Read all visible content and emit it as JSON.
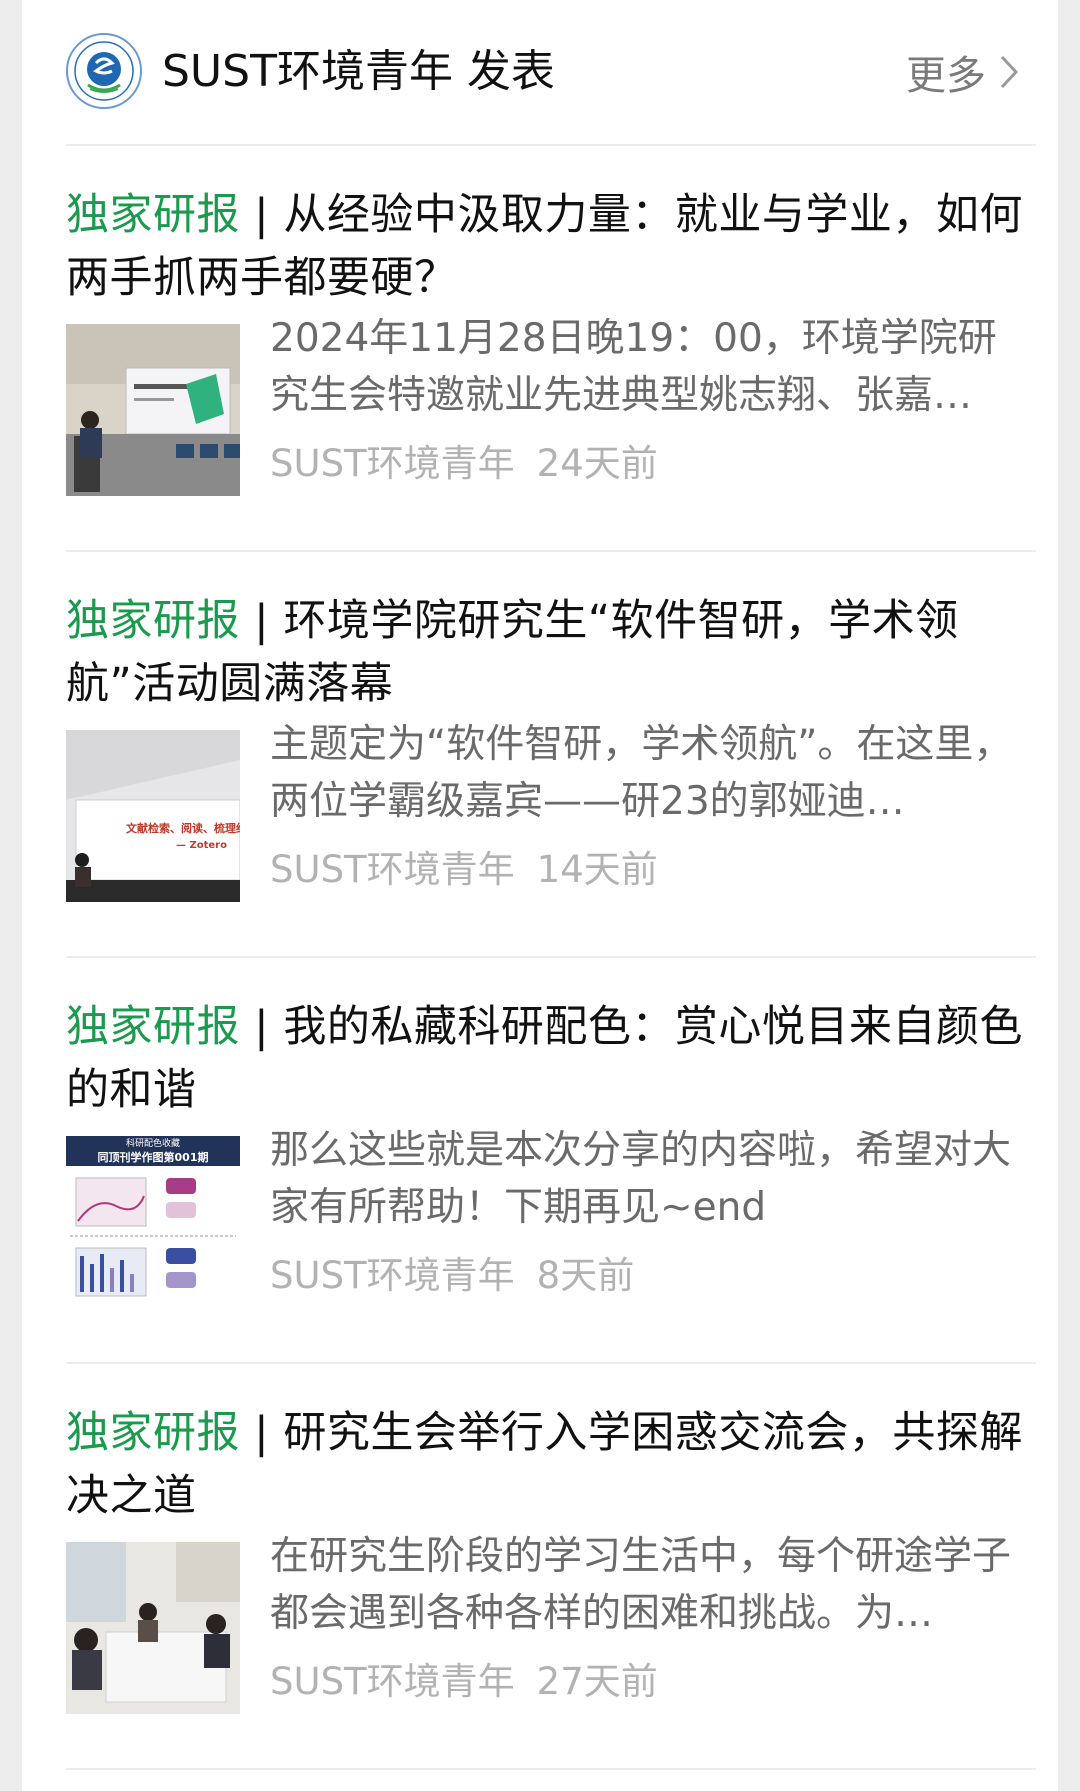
{
  "header": {
    "account_name": "SUST环境青年 发表",
    "more_label": "更多"
  },
  "articles": [
    {
      "tag": "独家研报",
      "separator": " | ",
      "title": "从经验中汲取力量：就业与学业，如何两手抓两手都要硬？",
      "summary": "2024年11月28日晚19：00，环境学院研究生会特邀就业先进典型姚志翔、张嘉…",
      "source": "SUST环境青年",
      "time": "24天前"
    },
    {
      "tag": "独家研报",
      "separator": " | ",
      "title": "环境学院研究生“软件智研，学术领航”活动圆满落幕",
      "summary": "主题定为“软件智研，学术领航”。在这里，两位学霸级嘉宾——研23的郭娅迪…",
      "source": "SUST环境青年",
      "time": "14天前",
      "thumb_text": [
        "文献检索、阅读、梳理经验",
        "— Zotero"
      ]
    },
    {
      "tag": "独家研报",
      "separator": " | ",
      "title": "我的私藏科研配色：赏心悦目来自颜色的和谐",
      "summary": "那么这些就是本次分享的内容啦，希望对大家有所帮助！下期再见~end",
      "source": "SUST环境青年",
      "time": "8天前",
      "thumb_text": [
        "科研配色收藏",
        "同顶刊学作图第001期"
      ]
    },
    {
      "tag": "独家研报",
      "separator": " | ",
      "title": "研究生会举行入学困惑交流会，共探解决之道",
      "summary": "在研究生阶段的学习生活中，每个研途学子都会遇到各种各样的困难和挑战。为…",
      "source": "SUST环境青年",
      "time": "27天前"
    }
  ],
  "colors": {
    "tag_green": "#1a9a4c",
    "title": "#111111",
    "summary": "#6a6a6a",
    "meta": "#b2b2b2"
  }
}
